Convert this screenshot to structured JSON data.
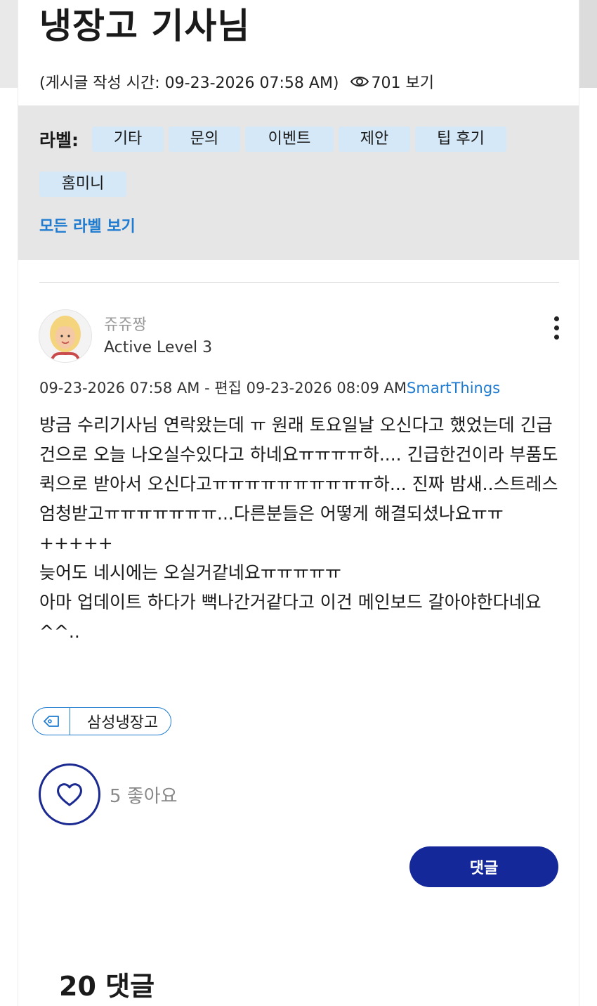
{
  "post": {
    "title": "냉장고 기사님",
    "meta_time": "(게시글 작성 시간: 09-23-2026 07:58 AM)",
    "views": "701 보기"
  },
  "labels": {
    "heading": "라벨:",
    "items": [
      "기타",
      "문의",
      "이벤트",
      "제안",
      "팁 후기",
      "홈미니"
    ],
    "all_link": "모든 라벨 보기"
  },
  "author": {
    "name": "쥬쥬짱",
    "level": "Active Level 3"
  },
  "post_info": {
    "dates": "09-23-2026 07:58 AM - 편집 09-23-2026 08:09 AM",
    "board": "SmartThings"
  },
  "body": [
    "방금 수리기사님 연락왔는데 ㅠ 원래 토요일날 오신다고 했었는데 긴급건으로 오늘 나오실수있다고 하네요ㅠㅠㅠㅠ하.... 긴급한건이라 부품도 퀵으로 받아서 오신다고ㅠㅠㅠㅠㅠㅠㅠㅠㅠㅠ하... 진짜 밤새..스트레스 엄청받고ㅠㅠㅠㅠㅠㅠㅠ...다른분들은 어떻게 해결되셨나요ㅠㅠ",
    "+++++",
    "늦어도 네시에는 오실거같네요ㅠㅠㅠㅠㅠ",
    "아마 업데이트 하다가 뻑나간거같다고 이건 메인보드 갈아야한다네요^^.."
  ],
  "tag": {
    "icon": "tag-icon",
    "label": "삼성냉장고"
  },
  "like": {
    "text": "5 좋아요",
    "icon": "heart-icon"
  },
  "reply_button": "댓글",
  "comments_heading": "20 댓글",
  "colors": {
    "accent_blue": "#1f7bd0",
    "button_navy": "#14289a",
    "chip_bg": "#d4e8f8",
    "labels_bg": "#e6e6e6"
  }
}
